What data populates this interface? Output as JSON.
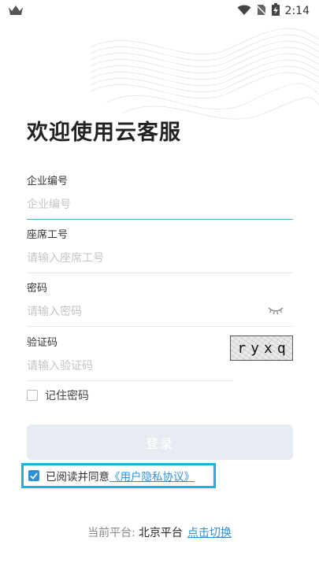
{
  "status_bar": {
    "time": "2:14"
  },
  "title": "欢迎使用云客服",
  "form": {
    "company": {
      "label": "企业编号",
      "placeholder": "企业编号"
    },
    "seat": {
      "label": "座席工号",
      "placeholder": "请输入座席工号"
    },
    "password": {
      "label": "密码",
      "placeholder": "请输入密码"
    },
    "captcha": {
      "label": "验证码",
      "placeholder": "请输入验证码",
      "image_text": "ryxq"
    }
  },
  "remember": {
    "label": "记住密码",
    "checked": false
  },
  "login_button": {
    "label": "登录"
  },
  "agreement": {
    "text": "已阅读并同意",
    "link": "《用户隐私协议》",
    "checked": true
  },
  "platform": {
    "prefix": "当前平台:",
    "name": "北京平台",
    "switch_label": "点击切换"
  },
  "colors": {
    "accent": "#2f8fd6",
    "highlight_border": "#1faee3",
    "button_bg": "#e7ecf2"
  },
  "icons": [
    "crown-icon",
    "wifi-icon",
    "no-sim-icon",
    "battery-charging-icon",
    "eye-closed-icon",
    "check-icon"
  ]
}
